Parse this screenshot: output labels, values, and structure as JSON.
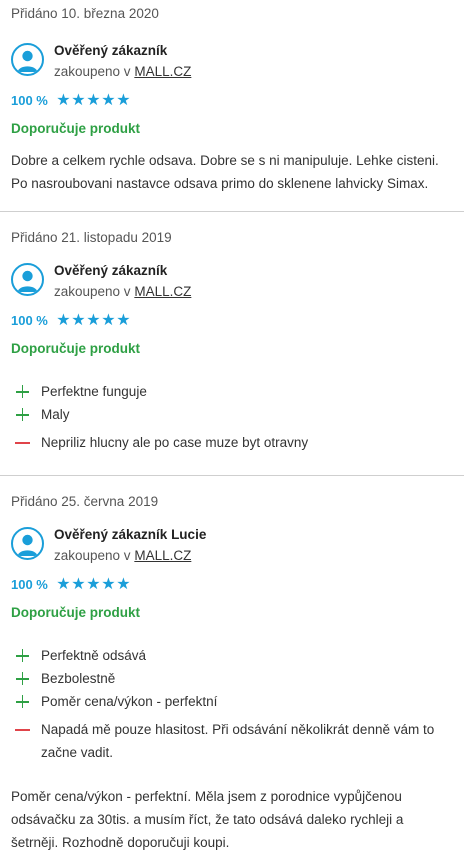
{
  "reviews": [
    {
      "date": "Přidáno 10. března 2020",
      "author": "Ověřený zákazník",
      "bought_prefix": "zakoupeno v",
      "shop": "MALL.CZ",
      "rating_percent": "100 %",
      "stars": 5,
      "recommend": "Doporučuje produkt",
      "pros": [],
      "cons": [],
      "text": "Dobre a celkem rychle odsava. Dobre se s ni manipuluje. Lehke cisteni. Po nasroubovani nastavce odsava primo do sklenene lahvicky Simax."
    },
    {
      "date": "Přidáno 21. listopadu 2019",
      "author": "Ověřený zákazník",
      "bought_prefix": "zakoupeno v",
      "shop": "MALL.CZ",
      "rating_percent": "100 %",
      "stars": 5,
      "recommend": "Doporučuje produkt",
      "pros": [
        "Perfektne funguje",
        "Maly"
      ],
      "cons": [
        "Nepriliz hlucny ale po case muze byt otravny"
      ],
      "text": ""
    },
    {
      "date": "Přidáno 25. června 2019",
      "author": "Ověřený zákazník Lucie",
      "bought_prefix": "zakoupeno v",
      "shop": "MALL.CZ",
      "rating_percent": "100 %",
      "stars": 5,
      "recommend": "Doporučuje produkt",
      "pros": [
        "Perfektně odsává",
        "Bezbolestně",
        "Poměr cena/výkon - perfektní"
      ],
      "cons": [
        "Napadá mě pouze hlasitost. Při odsávání několikrát denně vám to začne vadit."
      ],
      "text": "Poměr cena/výkon - perfektní. Měla jsem z porodnice vypůjčenou odsávačku za 30tis. a musím říct, že tato odsává daleko rychleji a šetrněji. Rozhodně doporučuji koupi."
    }
  ],
  "colors": {
    "accent": "#1a9ed9",
    "recommend": "#2ea044",
    "pro": "#2ea044",
    "con": "#e0444a",
    "divider": "#cfcfcf"
  },
  "icons": {
    "avatar": "user-avatar-icon",
    "star": "star-icon",
    "pro": "plus-icon",
    "con": "minus-icon"
  }
}
